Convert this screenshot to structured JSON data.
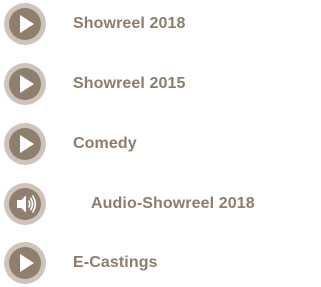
{
  "colors": {
    "icon_outer": "#cec4b9",
    "icon_inner": "#8f7f6e",
    "glyph": "#ffffff",
    "label": "#8c7d6c"
  },
  "items": [
    {
      "label": "Showreel 2018",
      "icon": "play-icon"
    },
    {
      "label": "Showreel 2015",
      "icon": "play-icon"
    },
    {
      "label": "Comedy",
      "icon": "play-icon"
    },
    {
      "label": "Audio-Showreel 2018",
      "icon": "speaker-icon"
    },
    {
      "label": "E-Castings",
      "icon": "play-icon"
    }
  ]
}
